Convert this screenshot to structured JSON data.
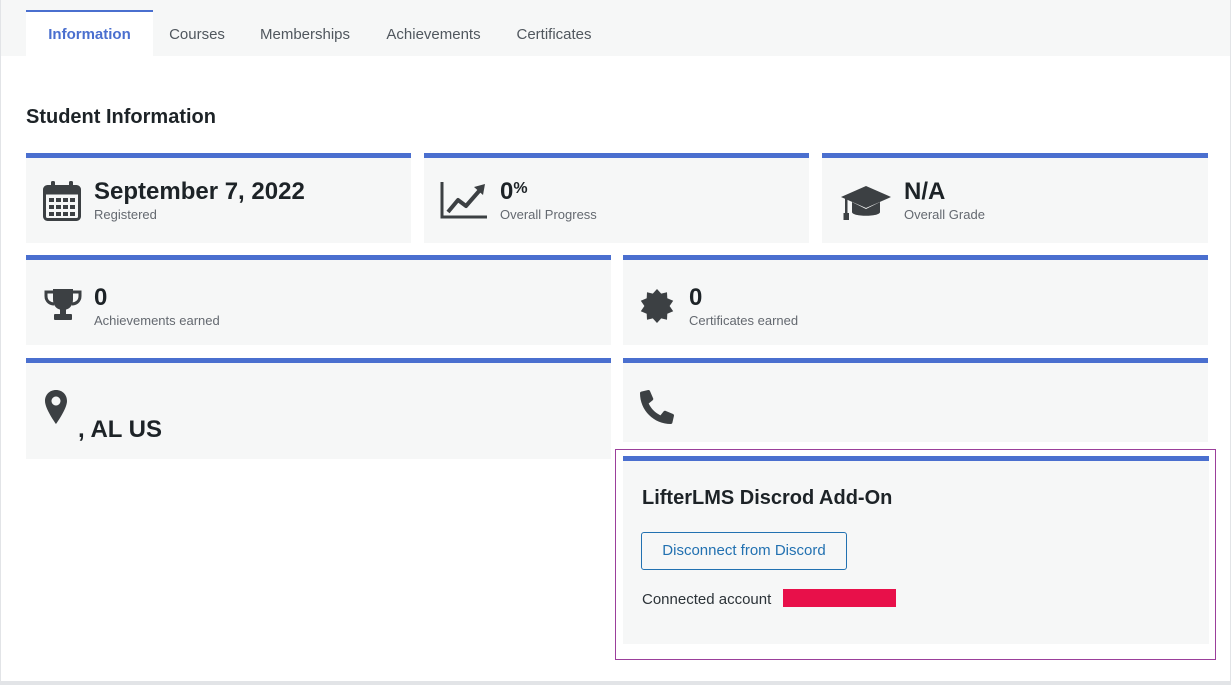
{
  "tabs": [
    {
      "label": "Information",
      "active": true
    },
    {
      "label": "Courses",
      "active": false
    },
    {
      "label": "Memberships",
      "active": false
    },
    {
      "label": "Achievements",
      "active": false
    },
    {
      "label": "Certificates",
      "active": false
    }
  ],
  "heading": "Student Information",
  "stats": {
    "registered": {
      "value": "September 7, 2022",
      "label": "Registered",
      "icon": "calendar-icon"
    },
    "progress": {
      "value": "0",
      "unit": "%",
      "label": "Overall Progress",
      "icon": "line-chart-icon"
    },
    "grade": {
      "value": "N/A",
      "label": "Overall Grade",
      "icon": "graduation-cap-icon"
    },
    "achievements": {
      "value": "0",
      "label": "Achievements earned",
      "icon": "trophy-icon"
    },
    "certificates": {
      "value": "0",
      "label": "Certificates earned",
      "icon": "certificate-icon"
    },
    "location": {
      "value": ", AL US",
      "icon": "map-pin-icon"
    },
    "phone": {
      "value": "",
      "icon": "phone-icon"
    }
  },
  "discord": {
    "title": "LifterLMS Discrod Add-On",
    "button_label": "Disconnect from Discord",
    "connected_label": "Connected account"
  },
  "colors": {
    "accent": "#4a6fcf",
    "card_bg": "#f6f7f7",
    "redaction": "#e8104a",
    "discord_outline": "#9b3f9b"
  }
}
